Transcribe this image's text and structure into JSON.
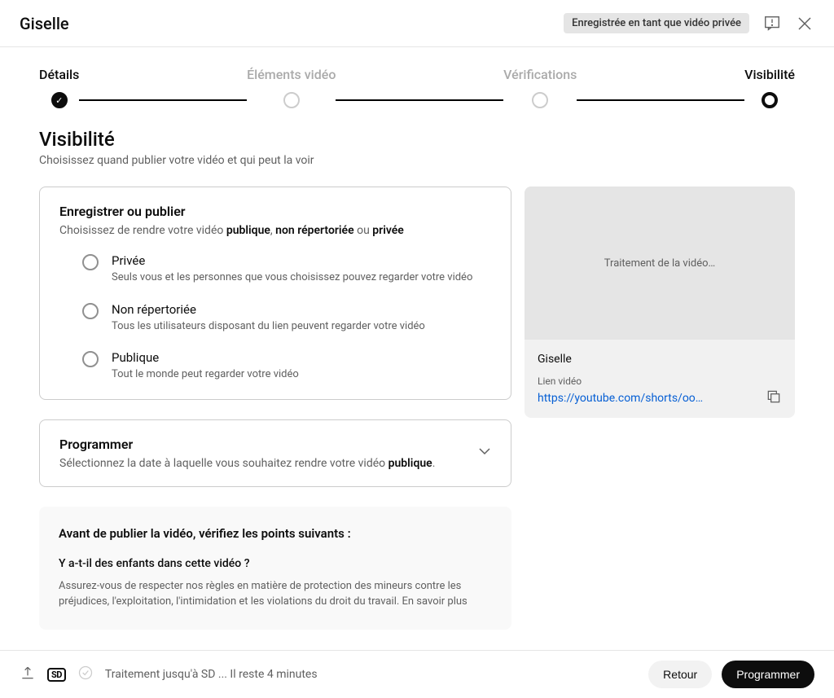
{
  "header": {
    "title": "Giselle",
    "badge": "Enregistrée en tant que vidéo privée"
  },
  "stepper": {
    "steps": [
      {
        "label": "Détails",
        "state": "completed"
      },
      {
        "label": "Éléments vidéo",
        "state": "inactive"
      },
      {
        "label": "Vérifications",
        "state": "inactive"
      },
      {
        "label": "Visibilité",
        "state": "current"
      }
    ]
  },
  "page": {
    "title": "Visibilité",
    "subtitle": "Choisissez quand publier votre vidéo et qui peut la voir"
  },
  "saveOrPublish": {
    "title": "Enregistrer ou publier",
    "desc_pre": "Choisissez de rendre votre vidéo ",
    "desc_b1": "publique",
    "desc_mid1": ", ",
    "desc_b2": "non répertoriée",
    "desc_mid2": " ou ",
    "desc_b3": "privée",
    "options": [
      {
        "label": "Privée",
        "sub": "Seuls vous et les personnes que vous choisissez pouvez regarder votre vidéo"
      },
      {
        "label": "Non répertoriée",
        "sub": "Tous les utilisateurs disposant du lien peuvent regarder votre vidéo"
      },
      {
        "label": "Publique",
        "sub": "Tout le monde peut regarder votre vidéo"
      }
    ]
  },
  "schedule": {
    "title": "Programmer",
    "desc_pre": "Sélectionnez la date à laquelle vous souhaitez rendre votre vidéo ",
    "desc_b": "publique",
    "desc_post": "."
  },
  "checklist": {
    "title": "Avant de publier la vidéo, vérifiez les points suivants :",
    "q1": "Y a-t-il des enfants dans cette vidéo ?",
    "p1": "Assurez-vous de respecter nos règles en matière de protection des mineurs contre les préjudices, l'exploitation, l'intimidation et les violations du droit du travail. En savoir plus"
  },
  "preview": {
    "processing": "Traitement de la vidéo…",
    "title": "Giselle",
    "linkLabel": "Lien vidéo",
    "link": "https://youtube.com/shorts/oo…"
  },
  "footer": {
    "sd": "SD",
    "status": "Traitement jusqu'à SD ... Il reste 4 minutes",
    "back": "Retour",
    "next": "Programmer"
  }
}
